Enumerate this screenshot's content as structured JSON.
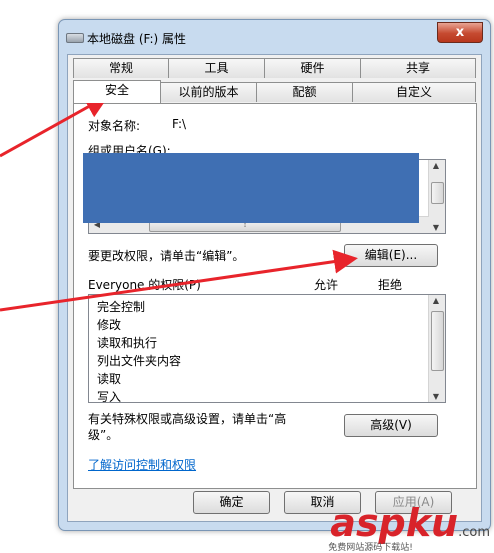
{
  "window": {
    "title": "本地磁盘 (F:) 属性",
    "close_symbol": "x"
  },
  "tabs_row1": [
    "常规",
    "工具",
    "硬件",
    "共享"
  ],
  "tabs_row2": [
    "安全",
    "以前的版本",
    "配额",
    "自定义"
  ],
  "active_tab": "安全",
  "security": {
    "object_name_label": "对象名称:",
    "object_name_value": "F:\\",
    "group_label": "组或用户名(G):",
    "change_hint": "要更改权限，请单击“编辑”。",
    "edit_button": "编辑(E)...",
    "permissions_label": "Everyone 的权限(P)",
    "allow_header": "允许",
    "deny_header": "拒绝",
    "permissions": [
      "完全控制",
      "修改",
      "读取和执行",
      "列出文件夹内容",
      "读取",
      "写入"
    ],
    "advanced_hint_line1": "有关特殊权限或高级设置，请单击“高",
    "advanced_hint_line2": "级”。",
    "advanced_button": "高级(V)",
    "link": "了解访问控制和权限"
  },
  "footer": {
    "ok": "确定",
    "cancel": "取消",
    "apply": "应用(A)"
  },
  "watermark": {
    "brand": "aspku",
    "suffix": ".com",
    "tagline": "免费网站源码下载站!"
  },
  "colors": {
    "annotation_arrow": "#e8242b",
    "redaction": "#3f6fb3",
    "link": "#0066cc",
    "window_frame": "#c8dbef"
  }
}
